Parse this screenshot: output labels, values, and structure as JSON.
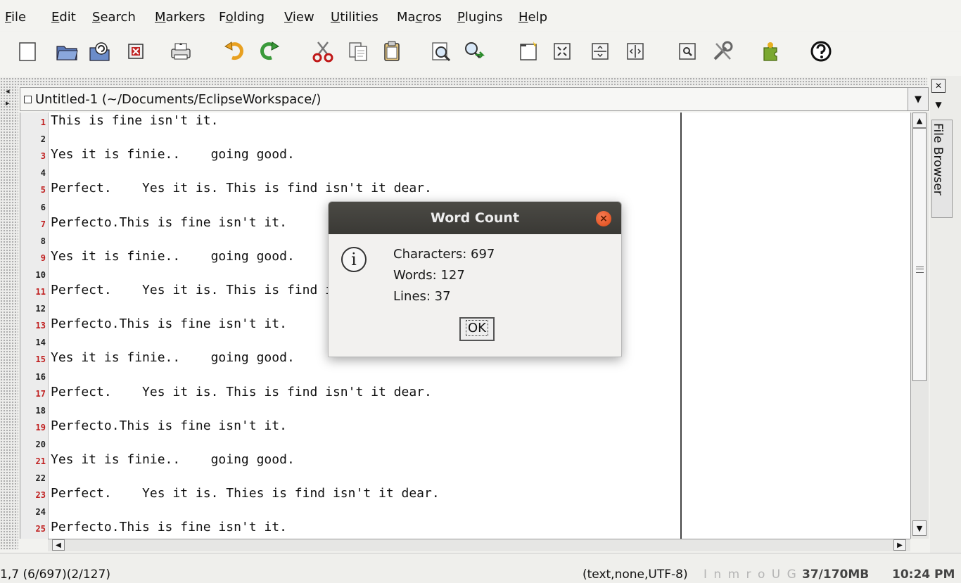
{
  "menubar": {
    "items": [
      {
        "pre": "",
        "u": "F",
        "post": "ile"
      },
      {
        "pre": "",
        "u": "E",
        "post": "dit"
      },
      {
        "pre": "",
        "u": "S",
        "post": "earch"
      },
      {
        "pre": "",
        "u": "M",
        "post": "arkers"
      },
      {
        "pre": "F",
        "u": "o",
        "post": "lding"
      },
      {
        "pre": "",
        "u": "V",
        "post": "iew"
      },
      {
        "pre": "",
        "u": "U",
        "post": "tilities"
      },
      {
        "pre": "Ma",
        "u": "c",
        "post": "ros"
      },
      {
        "pre": "",
        "u": "P",
        "post": "lugins"
      },
      {
        "pre": "",
        "u": "H",
        "post": "elp"
      }
    ]
  },
  "toolbar": {
    "icons": [
      "new-file-icon",
      "open-file-icon",
      "reload-icon",
      "close-file-icon",
      "print-icon",
      "undo-icon",
      "redo-icon",
      "cut-icon",
      "copy-icon",
      "paste-icon",
      "find-icon",
      "find-next-icon",
      "new-view-icon",
      "unsplit-icon",
      "split-horizontal-icon",
      "split-vertical-icon",
      "buffer-options-icon",
      "global-options-icon",
      "plugin-manager-icon",
      "help-icon"
    ]
  },
  "buffer": {
    "title": "Untitled-1 (~/Documents/EclipseWorkspace/)"
  },
  "editor": {
    "line_numbers": [
      "1",
      "2",
      "3",
      "4",
      "5",
      "6",
      "7",
      "8",
      "9",
      "10",
      "11",
      "12",
      "13",
      "14",
      "15",
      "16",
      "17",
      "18",
      "19",
      "20",
      "21",
      "22",
      "23",
      "24",
      "25"
    ],
    "lines": [
      "This is fine isn't it.",
      "",
      "Yes it is finie..    going good.",
      "",
      "Perfect.    Yes it is. This is find isn't it dear.",
      "",
      "Perfecto.This is fine isn't it.",
      "",
      "Yes it is finie..    going good.",
      "",
      "Perfect.    Yes it is. This is find isn't it dear.",
      "",
      "Perfecto.This is fine isn't it.",
      "",
      "Yes it is finie..    going good.",
      "",
      "Perfect.    Yes it is. This is find isn't it dear.",
      "",
      "Perfecto.This is fine isn't it.",
      "",
      "Yes it is finie..    going good.",
      "",
      "Perfect.    Yes it is. Thies is find isn't it dear.",
      "",
      "Perfecto.This is fine isn't it."
    ]
  },
  "dock": {
    "tab_label": "File Browser"
  },
  "dialog": {
    "title": "Word Count",
    "characters": "Characters: 697",
    "words": "Words: 127",
    "lines": "Lines: 37",
    "ok_label": "OK"
  },
  "status": {
    "position": "1,7 (6/697)(2/127)",
    "mode": "(text,none,UTF-8)",
    "flags": "I n m r o U G",
    "memory": "37/170MB",
    "time": "10:24 PM"
  },
  "colors": {
    "line_number_odd": "#c02020",
    "dialog_titlebar": "#3f3e3a",
    "dialog_close": "#dd4814"
  }
}
